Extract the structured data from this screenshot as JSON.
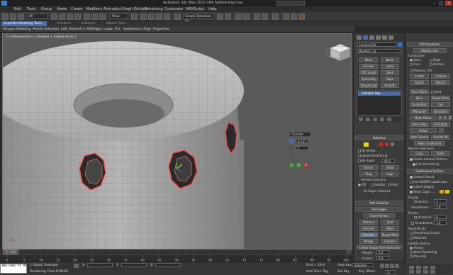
{
  "window": {
    "title": "Autodesk 3ds Max 2017 x64    Sphere Ray.max",
    "search_placeholder": "Type a keyword or phrase"
  },
  "menu": [
    "Edit",
    "Tools",
    "Group",
    "Views",
    "Create",
    "Modifiers",
    "Animation",
    "Graph Editors",
    "Rendering",
    "Customize",
    "MAXScript",
    "Help"
  ],
  "toolbar": {
    "selection_filter": "All",
    "view_dropdown": "View",
    "selection_set": "Create Selection Se"
  },
  "ribbon": {
    "active_tab": "Graphite Modeling Tools",
    "tabs": [
      "Freeform",
      "Selection",
      "Object Paint"
    ],
    "items": [
      "Polygon Modeling",
      "Modify Selection",
      "Edit",
      "Geometry (All)",
      "Edges",
      "Loops",
      "Tris",
      "Subdivision",
      "Align",
      "Properties"
    ]
  },
  "viewport": {
    "label": "[+] [Perspective ] [ Shaded + Edged Faces ]"
  },
  "caddy": {
    "title": "Chamfer",
    "amount": "0.127",
    "segments": "2"
  },
  "command_panel": {
    "object_name": "Cylinder032",
    "modifier_list": "Modifier List",
    "buttons": [
      [
        "Bend",
        "Noise"
      ],
      [
        "Extrude",
        "Lathe"
      ],
      [
        "FFD 3x3x3",
        "Shell"
      ],
      [
        "Symmetry",
        "Taper"
      ],
      [
        "TurboSmooth",
        "Smooth"
      ]
    ],
    "stack_item": "Editable Poly",
    "selection": {
      "head": "Selection",
      "by_vertex": "By Vertex",
      "ignore_backfacing": "Ignore Backfacing",
      "by_angle": "By Angle",
      "angle_value": "45.0",
      "shrink": "Shrink",
      "grow": "Grow",
      "ring": "Ring",
      "loop": "Loop",
      "preview_selection": "Preview Selection",
      "preview_options": [
        "Off",
        "SubObj",
        "Multi"
      ],
      "status": "64 Edges Selected"
    },
    "soft_selection": "Soft Selection",
    "edit_edges": {
      "head": "Edit Edges",
      "insert_vertex": "Insert Vertex",
      "rows": [
        [
          "Remove",
          "Split"
        ],
        [
          "Extrude",
          "Weld"
        ],
        [
          "Chamfer",
          "Target Weld"
        ],
        [
          "Bridge",
          "Connect"
        ]
      ],
      "create_shape": "Create Shape From Selection",
      "weight_label": "Weight:",
      "weight_value": "1.0",
      "crease_label": "Crease:",
      "crease_value": "0.0"
    }
  },
  "modifier_panel": {
    "edit_geometry": "Edit Geometry",
    "repeat_last": "Repeat Last",
    "constraints": "Constraints",
    "constraint_options": [
      "None",
      "Edge",
      "Face",
      "Normal"
    ],
    "preserve_uvs": "Preserve UVs",
    "create": "Create",
    "collapse": "Collapse",
    "attach": "Attach",
    "detach": "Detach",
    "slice_plane": "Slice Plane",
    "split": "Split",
    "slice": "Slice",
    "reset_plane": "Reset Plane",
    "quickslice": "QuickSlice",
    "cut": "Cut",
    "msmooth": "MSmooth",
    "tessellate": "Tessellate",
    "make_planar": "Make Planar",
    "xyz": [
      "X",
      "Y",
      "Z"
    ],
    "view_align": "View Align",
    "grid_align": "Grid Align",
    "relax": "Relax",
    "hide_selected": "Hide Selected",
    "unhide_all": "Unhide All",
    "hide_unselected": "Hide Unselected",
    "named_selections": "Named Selections:",
    "copy": "Copy",
    "paste": "Paste",
    "delete_isolated": "Delete Isolated Vertices",
    "full_interactivity": "Full Interactivity",
    "subdivision_surface": "Subdivision Surface",
    "smooth_result": "Smooth Result",
    "use_nurms": "Use NURMS Subdivision",
    "isoline_display": "Isoline Display",
    "show_cage": "Show Cage......",
    "display": "Display",
    "iterations_label": "Iterations:",
    "iterations_value": "1",
    "smoothness_label": "Smoothness:",
    "smoothness_value": "1.0",
    "render": "Render",
    "render_iterations_value": "0",
    "render_smoothness_value": "1.0",
    "separate_by": "Separate By",
    "smoothing_groups": "Smoothing Groups",
    "materials": "Materials",
    "update_options": "Update Options",
    "always": "Always",
    "when_rendering": "When Rendering",
    "manually": "Manually"
  },
  "timeline": {
    "range": "0 / 100",
    "ticks": [
      "0",
      "5",
      "10",
      "15",
      "20",
      "25",
      "30",
      "35",
      "40",
      "45",
      "50",
      "55",
      "60",
      "65",
      "70",
      "75",
      "80",
      "85",
      "90",
      "95",
      "100"
    ]
  },
  "status": {
    "listener": "Welcome to MAXScript.",
    "selection": "1 Object Selected",
    "prompt": "Rendering Time  0:00:00",
    "x_label": "X:",
    "y_label": "Y:",
    "z_label": "Z:",
    "grid": "Grid = 10.0",
    "auto_key": "Auto Key",
    "selected": "Selected",
    "set_key": "Set Key",
    "key_filters": "Key Filters...",
    "add_time_tag": "Add Time Tag",
    "frame": "0"
  },
  "colors": {
    "accent": "#4a6fa5",
    "selection_edge": "#ff4a4a",
    "caddy_ok": "#3b8f3b"
  }
}
